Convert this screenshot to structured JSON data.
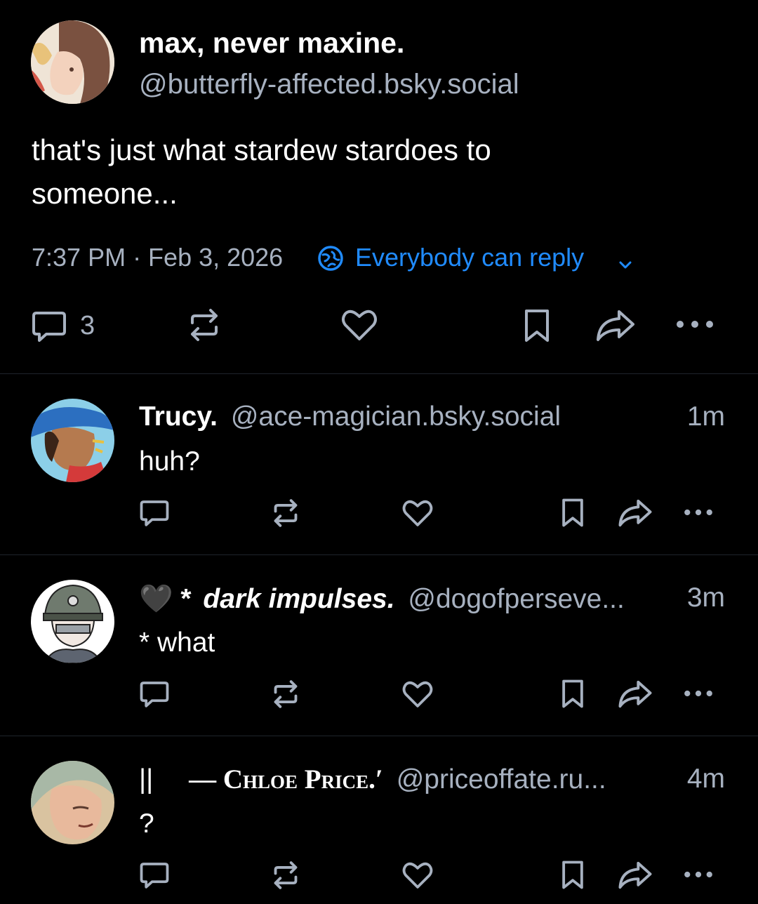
{
  "main_post": {
    "display_name": "max, never maxine.",
    "handle": "@butterfly-affected.bsky.social",
    "text_line1": "that's just what stardew stardoes to",
    "text_line2": "someone...",
    "timestamp": "7:37 PM · Feb 3, 2026",
    "reply_setting": "Everybody can reply",
    "reply_count": "3",
    "icons": [
      "reply-icon",
      "repost-icon",
      "like-icon",
      "bookmark-icon",
      "share-icon",
      "more-icon",
      "globe-icon",
      "chevron-down-icon"
    ]
  },
  "replies": [
    {
      "prefix": "",
      "display_name": "Trucy.",
      "handle": "@ace-magician.bsky.social",
      "time": "1m",
      "text": "huh?"
    },
    {
      "prefix": "🖤 *",
      "display_name": "dark impulses.",
      "handle": "@dogofperseve...",
      "time": "3m",
      "text": "* what"
    },
    {
      "prefix": "||",
      "display_name": "— Chloe Price.′",
      "handle": "@priceoffate.ru...",
      "time": "4m",
      "text": "?"
    }
  ],
  "colors": {
    "background": "#000000",
    "text": "#ffffff",
    "muted": "#a7b1c0",
    "accent": "#208bfe",
    "divider": "#1f242c"
  }
}
